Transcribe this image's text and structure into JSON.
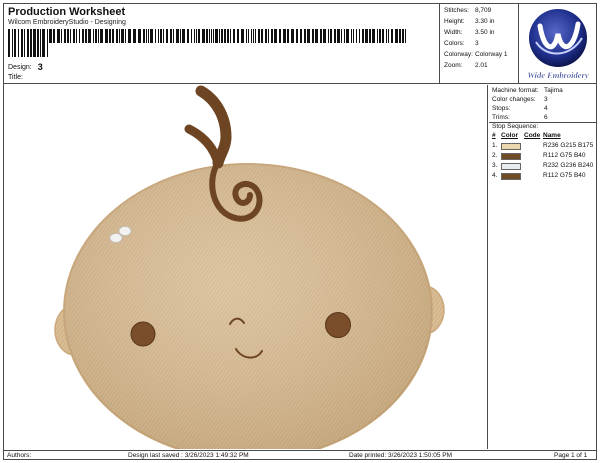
{
  "header": {
    "title": "Production Worksheet",
    "software": "Wilcom EmbroideryStudio - Designing",
    "design_label": "Design:",
    "design_value": "3",
    "title_label": "Title:"
  },
  "stats": [
    {
      "label": "Stitches:",
      "value": "8,709"
    },
    {
      "label": "Height:",
      "value": "3.30 in"
    },
    {
      "label": "Width:",
      "value": "3.50 in"
    },
    {
      "label": "Colors:",
      "value": "3"
    },
    {
      "label": "Colorway:",
      "value": "Colorway 1"
    },
    {
      "label": "Zoom:",
      "value": "2.01"
    }
  ],
  "logo": {
    "text": "Wide Embroidery",
    "accent": "#1f2f8c"
  },
  "machine": [
    {
      "label": "Machine format:",
      "value": "Tajima"
    },
    {
      "label": "Color changes:",
      "value": "3"
    },
    {
      "label": "Stops:",
      "value": "4"
    },
    {
      "label": "Trims:",
      "value": "6"
    }
  ],
  "stop_sequence": {
    "title": "Stop Sequence:",
    "columns": [
      "#",
      "Color",
      "Code",
      "Name"
    ],
    "rows": [
      {
        "num": "1.",
        "color": "#ecd7af",
        "name": "R236 G215 B175"
      },
      {
        "num": "2.",
        "color": "#704b28",
        "name": "R112 G75 B40"
      },
      {
        "num": "3.",
        "color": "#e8ecf0",
        "name": "R232 G236 B240"
      },
      {
        "num": "4.",
        "color": "#704b28",
        "name": "R112 G75 B40"
      }
    ]
  },
  "footer": {
    "authors_label": "Authors:",
    "last_saved": "Design last saved : 3/26/2023 1:49:32 PM",
    "printed": "Date printed: 3/26/2023 1:50:05 PM",
    "page": "Page 1 of 1"
  }
}
